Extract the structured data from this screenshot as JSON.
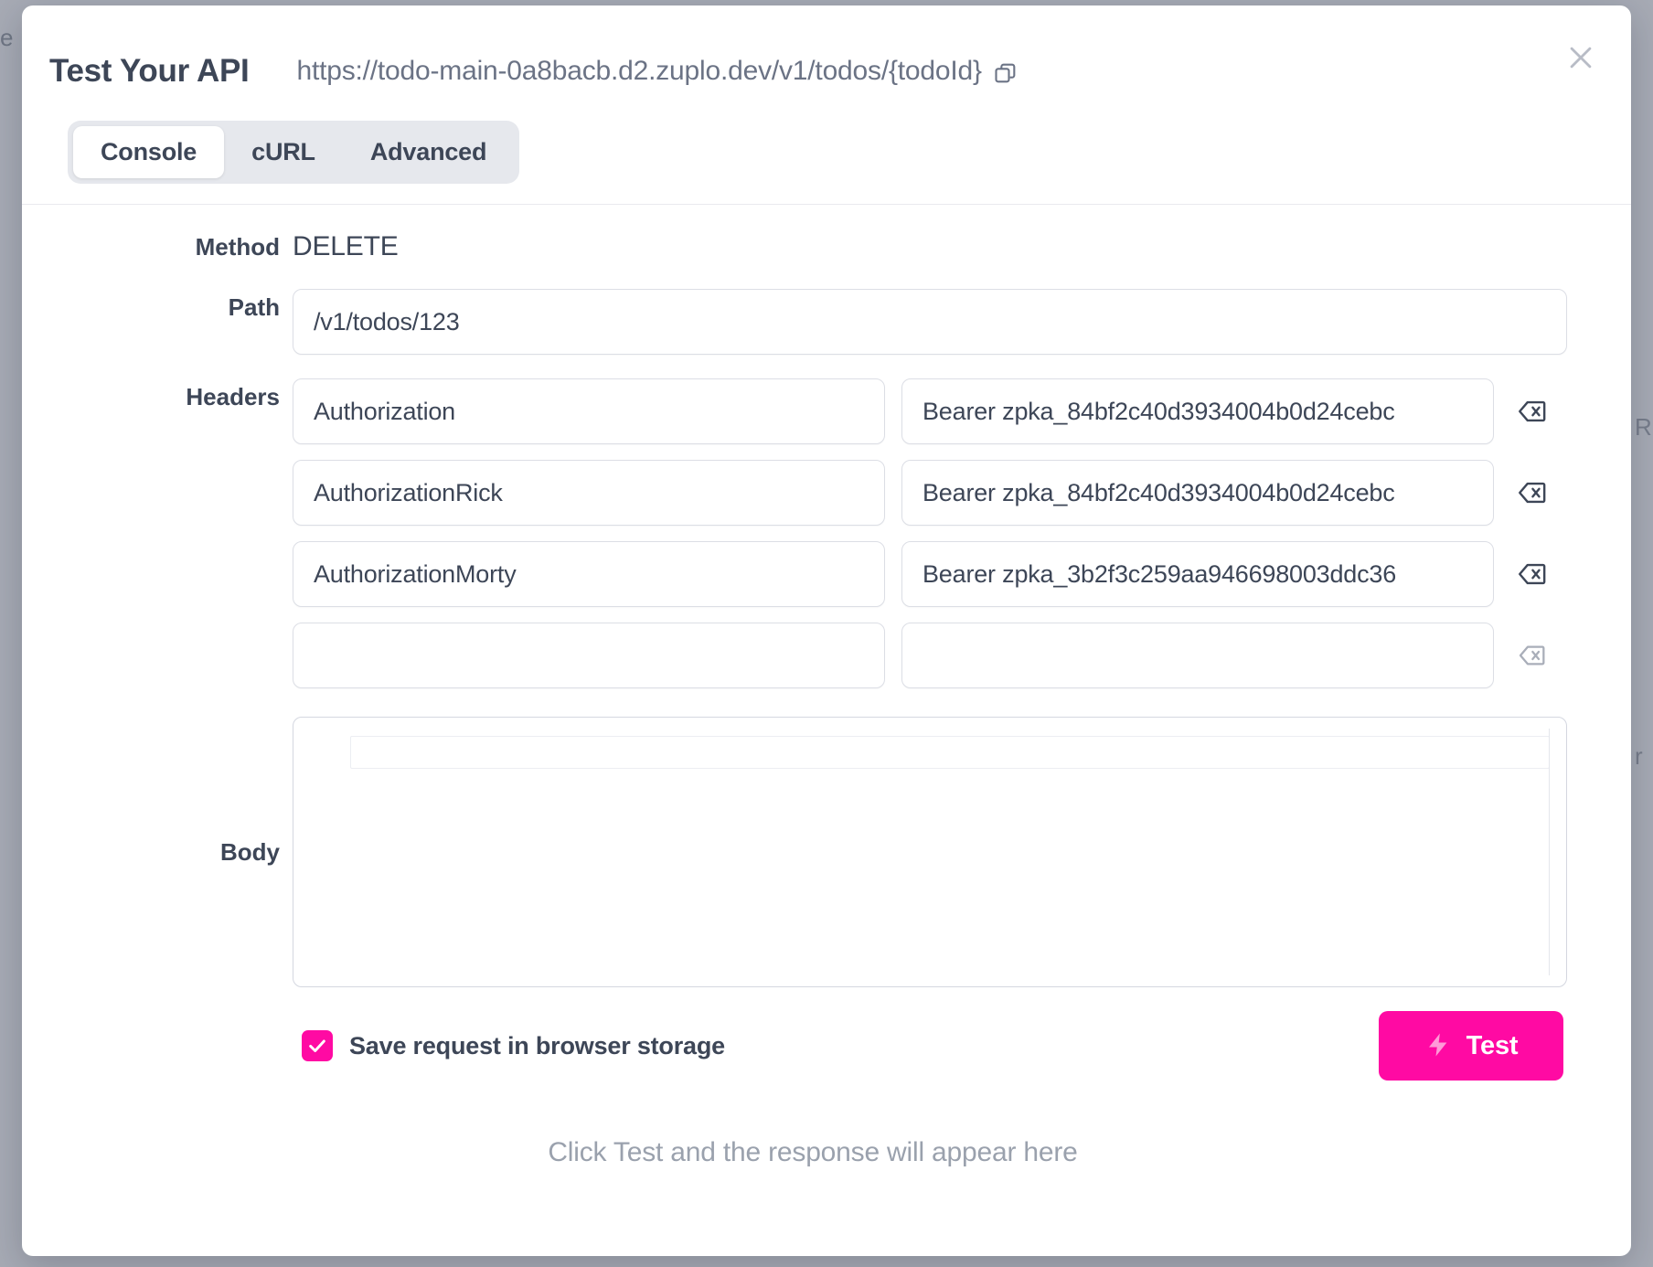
{
  "modal": {
    "title": "Test Your API",
    "url": "https://todo-main-0a8bacb.d2.zuplo.dev/v1/todos/{todoId}",
    "copy_icon": "copy-icon",
    "close_icon": "close-icon"
  },
  "tabs": [
    {
      "label": "Console",
      "active": true
    },
    {
      "label": "cURL",
      "active": false
    },
    {
      "label": "Advanced",
      "active": false
    }
  ],
  "form": {
    "method_label": "Method",
    "method_value": "DELETE",
    "path_label": "Path",
    "path_value": "/v1/todos/123",
    "headers_label": "Headers",
    "headers": [
      {
        "name": "Authorization",
        "value": "Bearer zpka_84bf2c40d3934004b0d24cebc",
        "delete_enabled": true
      },
      {
        "name": "AuthorizationRick",
        "value": "Bearer zpka_84bf2c40d3934004b0d24cebc",
        "delete_enabled": true
      },
      {
        "name": "AuthorizationMorty",
        "value": "Bearer zpka_3b2f3c259aa946698003ddc36",
        "delete_enabled": true
      },
      {
        "name": "",
        "value": "",
        "delete_enabled": false
      }
    ],
    "body_label": "Body",
    "body_value": ""
  },
  "footer": {
    "save_checkbox_label": "Save request in browser storage",
    "save_checkbox_checked": true,
    "test_button_label": "Test",
    "test_button_icon": "lightning-bolt-icon"
  },
  "response": {
    "placeholder": "Click Test and the response will appear here"
  },
  "colors": {
    "accent": "#ff0aa3",
    "text": "#3d4657",
    "muted": "#9aa1ad",
    "border": "#dcdee5",
    "backdrop": "#a7abb5"
  },
  "background": {
    "ghost_left": "e",
    "ghost_right_top": "R",
    "ghost_right_bottom": "r"
  }
}
